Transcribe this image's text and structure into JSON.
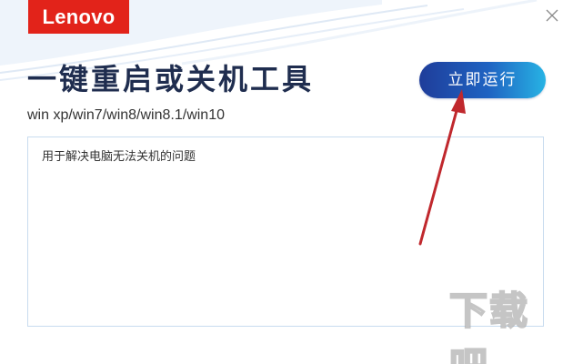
{
  "brand": {
    "logo_text": "Lenovo",
    "color": "#e2231a"
  },
  "window": {
    "close_icon": "close-icon"
  },
  "header": {
    "title": "一键重启或关机工具",
    "subtitle": "win xp/win7/win8/win8.1/win10"
  },
  "actions": {
    "run_label": "立即运行",
    "run_gradient": [
      "#1f3d9a",
      "#27b3e4"
    ]
  },
  "content": {
    "description": "用于解决电脑无法关机的问题"
  },
  "annotation": {
    "arrow_color": "#c0282d"
  },
  "watermark": {
    "text": "下载吧"
  }
}
